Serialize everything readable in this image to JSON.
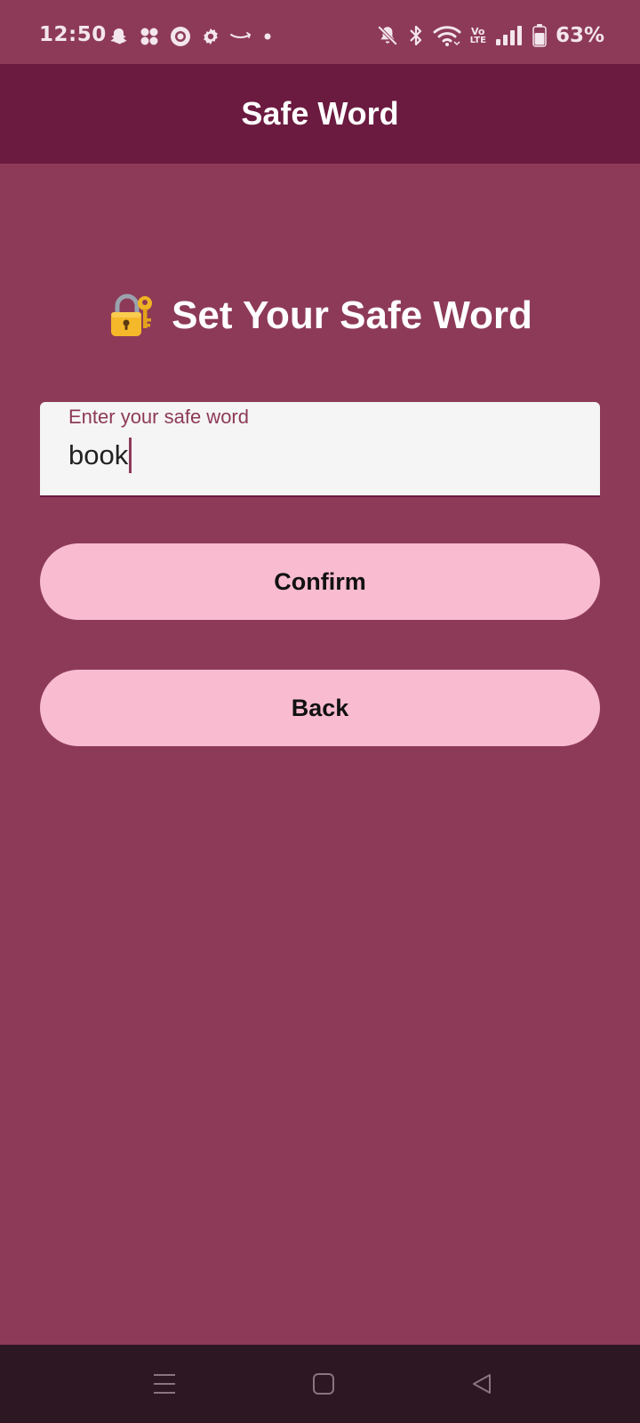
{
  "status_bar": {
    "time": "12:50",
    "battery": "63%",
    "left_icons": [
      "snapchat-icon",
      "clover-app-icon",
      "circle-app-icon",
      "settings-gear-icon",
      "amazon-icon",
      "dot-icon"
    ],
    "right_icons": [
      "bell-muted-icon",
      "bluetooth-icon",
      "wifi-icon",
      "volte-icon",
      "signal-icon",
      "battery-icon"
    ],
    "volte_top": "Vo",
    "volte_bottom": "LTE"
  },
  "app_bar": {
    "title": "Safe Word"
  },
  "main": {
    "heading_icon": "lock-with-key-icon",
    "heading": "Set Your Safe Word",
    "input": {
      "label": "Enter your safe word",
      "value": "book"
    },
    "confirm_label": "Confirm",
    "back_label": "Back"
  },
  "nav_bar": {
    "icons": [
      "menu-lines-icon",
      "home-square-icon",
      "back-triangle-icon"
    ]
  },
  "colors": {
    "background": "#8d3a58",
    "app_bar": "#6b1a40",
    "button": "#f8bbd0",
    "input_bg": "#f5f5f5",
    "nav_bar": "#2d1722"
  }
}
